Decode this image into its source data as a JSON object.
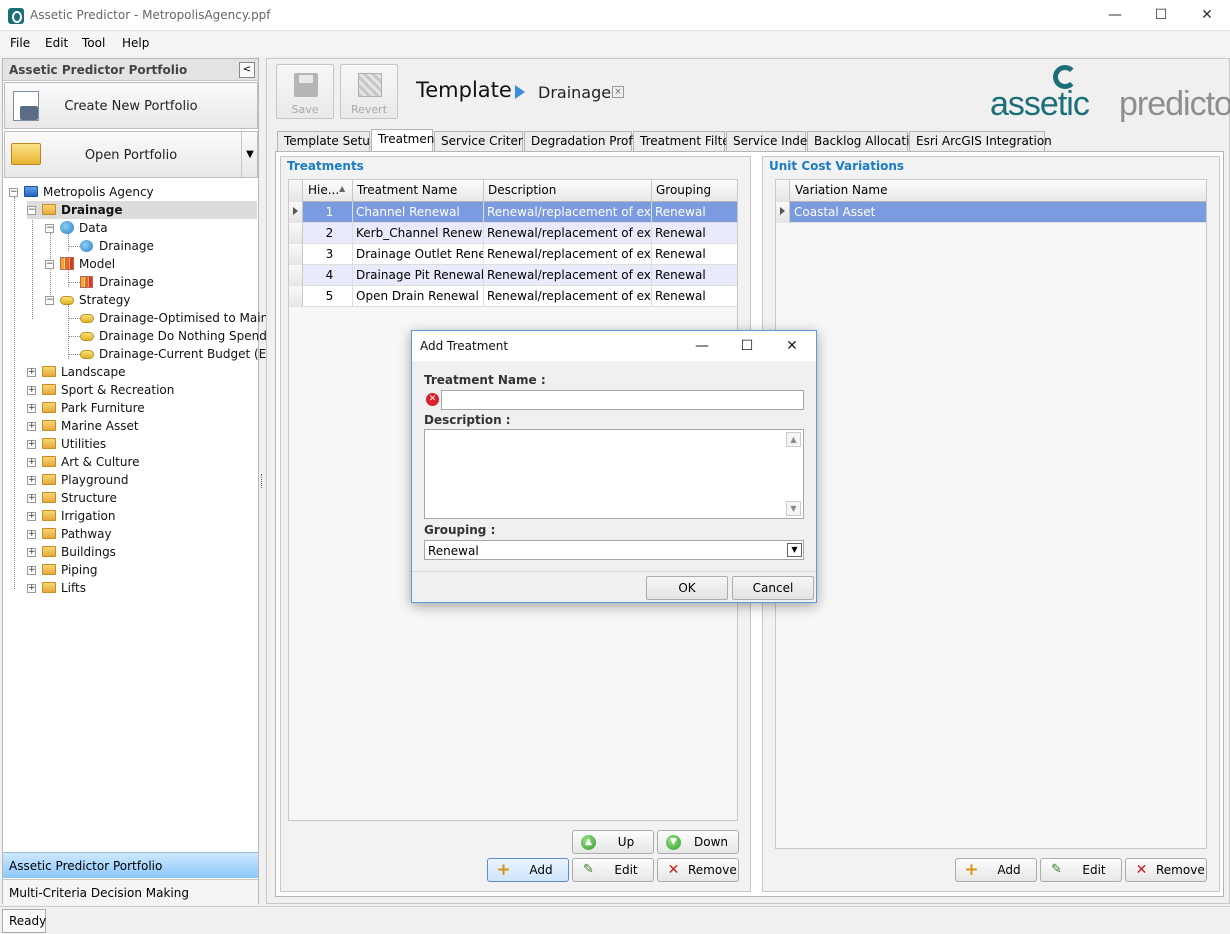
{
  "window": {
    "title": "Assetic Predictor - MetropolisAgency.ppf",
    "minimize": "—",
    "maximize": "☐",
    "close": "✕"
  },
  "menu": [
    "File",
    "Edit",
    "Tool",
    "Help"
  ],
  "left_panel": {
    "header": "Assetic Predictor Portfolio",
    "create_portfolio": "Create New Portfolio",
    "open_portfolio": "Open Portfolio",
    "tree": {
      "root": "Metropolis Agency",
      "drainage": "Drainage",
      "data": "Data",
      "data_item": "Drainage",
      "model": "Model",
      "model_item": "Drainage",
      "strategy": "Strategy",
      "strategy_items": [
        "Drainage-Optimised to Maintai...",
        "Drainage Do Nothing Spend S...",
        "Drainage-Current Budget (Est..."
      ],
      "categories": [
        "Landscape",
        "Sport & Recreation",
        "Park Furniture",
        "Marine Asset",
        "Utilities",
        "Art & Culture",
        "Playground",
        "Structure",
        "Irrigation",
        "Pathway",
        "Buildings",
        "Piping",
        "Lifts"
      ]
    },
    "footer_active": "Assetic Predictor Portfolio",
    "footer_other": "Multi-Criteria Decision Making"
  },
  "toolbar": {
    "save": "Save",
    "revert": "Revert"
  },
  "template": {
    "title": "Template",
    "name": "Drainage",
    "close": "×"
  },
  "logo": {
    "part1": "assetic",
    "part2": "predictor"
  },
  "tabs": [
    "Template Setup",
    "Treatment",
    "Service Criteria",
    "Degradation Profile",
    "Treatment Filter",
    "Service Index",
    "Backlog Allocation",
    "Esri ArcGIS Integration"
  ],
  "active_tab": "Treatment",
  "treatments": {
    "header": "Treatments",
    "columns": [
      "Hie...",
      "Treatment Name",
      "Description",
      "Grouping"
    ],
    "rows": [
      {
        "h": "1",
        "name": "Channel Renewal",
        "desc": "Renewal/replacement of existi...",
        "group": "Renewal"
      },
      {
        "h": "2",
        "name": "Kerb_Channel Renewal",
        "desc": "Renewal/replacement of existi...",
        "group": "Renewal"
      },
      {
        "h": "3",
        "name": "Drainage Outlet Renewal",
        "desc": "Renewal/replacement of existi...",
        "group": "Renewal"
      },
      {
        "h": "4",
        "name": "Drainage Pit Renewal",
        "desc": "Renewal/replacement of existi...",
        "group": "Renewal"
      },
      {
        "h": "5",
        "name": "Open Drain Renewal",
        "desc": "Renewal/replacement of existi...",
        "group": "Renewal"
      }
    ],
    "buttons": {
      "up": "Up",
      "down": "Down",
      "add": "Add",
      "edit": "Edit",
      "remove": "Remove"
    }
  },
  "unit_cost": {
    "header": "Unit Cost Variations",
    "column": "Variation Name",
    "rows": [
      "Coastal Asset"
    ],
    "buttons": {
      "add": "Add",
      "edit": "Edit",
      "remove": "Remove"
    }
  },
  "status": "Ready",
  "dialog": {
    "title": "Add Treatment",
    "name_label": "Treatment Name :",
    "name_value": "",
    "desc_label": "Description :",
    "desc_value": "",
    "grouping_label": "Grouping :",
    "grouping_value": "Renewal",
    "ok": "OK",
    "cancel": "Cancel"
  },
  "colors": {
    "accent": "#1a7cc5",
    "selected_row": "#7b9be0",
    "brand": "#1c6f78"
  }
}
